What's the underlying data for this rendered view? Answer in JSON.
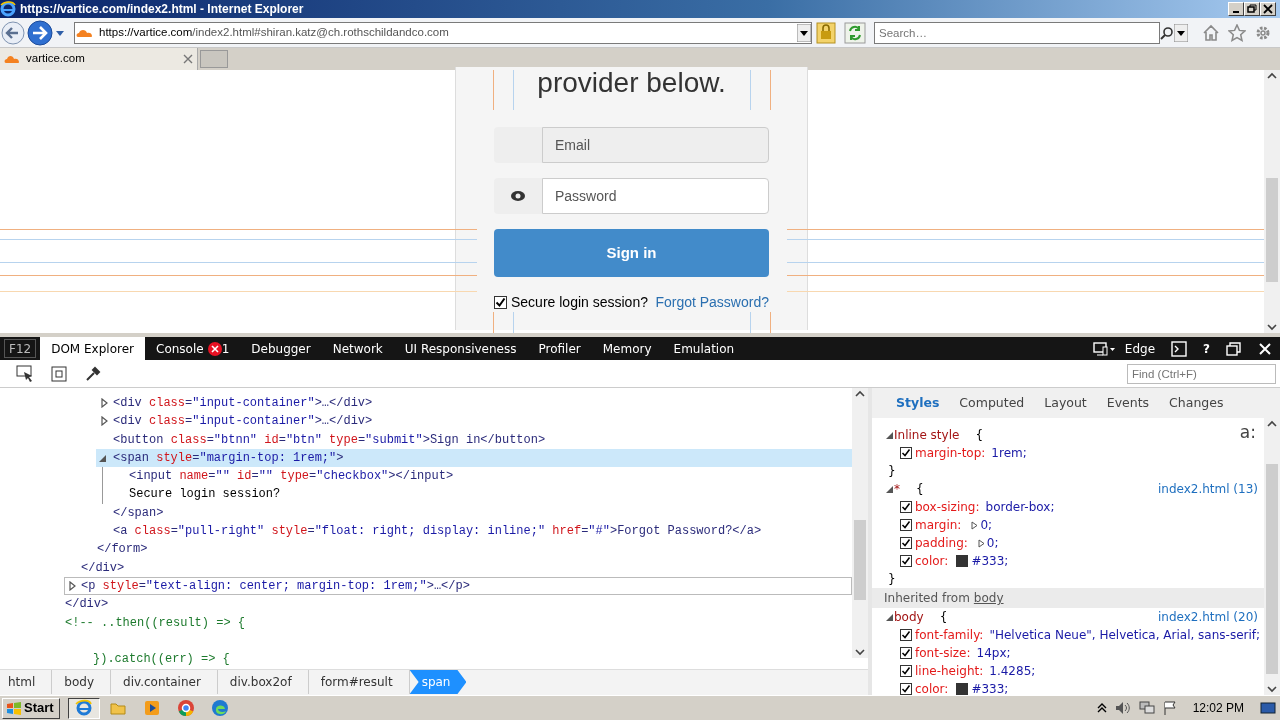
{
  "browser": {
    "title": "https://vartice.com/index2.html - Internet Explorer",
    "address": {
      "host": "https://vartice.com",
      "path": "/index2.html#shiran.katz@ch.rothschildandco.com"
    },
    "search": {
      "placeholder": "Search…"
    },
    "tabs": [
      {
        "label": "vartice.com",
        "selected": true
      }
    ]
  },
  "page": {
    "heading": "provider below.",
    "fields": [
      {
        "kind": "plain",
        "placeholder": "Email",
        "disabled": true
      },
      {
        "kind": "reveal",
        "placeholder": "Password",
        "disabled": false
      }
    ],
    "submit": "Sign in",
    "remember": {
      "label": "Secure login session?",
      "checked": true
    },
    "forgot": "Forgot Password?"
  },
  "devtools": {
    "key_label": "F12",
    "tabs": [
      {
        "label": "DOM Explorer",
        "selected": true
      },
      {
        "label": "Console",
        "selected": false,
        "errors": "1"
      },
      {
        "label": "Debugger",
        "selected": false
      },
      {
        "label": "Network",
        "selected": false
      },
      {
        "label": "UI Responsiveness",
        "selected": false
      },
      {
        "label": "Profiler",
        "selected": false
      },
      {
        "label": "Memory",
        "selected": false
      },
      {
        "label": "Emulation",
        "selected": false
      }
    ],
    "mode": "Edge",
    "help": "?",
    "find": {
      "placeholder": "Find (Ctrl+F)"
    },
    "dom_tree": [
      {
        "close": "</div>",
        "children": [
          {
            "close": "</div>",
            "children": [
              {
                "close": "</form>",
                "children": [
                  {
                    "text": "<div class=\"input-container\">…</div>",
                    "expanded": false,
                    "selected": false,
                    "hovered": false
                  },
                  {
                    "text": "<div class=\"input-container\">…</div>",
                    "expanded": false,
                    "selected": false,
                    "hovered": false
                  },
                  {
                    "text": "<button class=\"btnn\" id=\"btn\" type=\"submit\">Sign in</button>",
                    "selected": false,
                    "hovered": false
                  },
                  {
                    "text": "<span style=\"margin-top: 1rem;\">",
                    "expanded": true,
                    "selected": true,
                    "hovered": false,
                    "close": "</span>",
                    "children": [
                      {
                        "text": "<input name=\"\" id=\"\" type=\"checkbox\"></input>",
                        "selected": false,
                        "hovered": false
                      },
                      {
                        "kind": "text",
                        "text": "Secure login session?",
                        "selected": false,
                        "hovered": false
                      }
                    ]
                  },
                  {
                    "text": "<a class=\"pull-right\" style=\"float: right; display: inline;\" href=\"#\">Forgot Password?</a>",
                    "selected": false,
                    "hovered": false
                  }
                ]
              }
            ]
          },
          {
            "text": "<p style=\"text-align: center; margin-top: 1rem;\">…</p>",
            "expanded": false,
            "selected": false,
            "hovered": true
          }
        ]
      },
      {
        "kind": "comment",
        "lines": [
          "<!-- ..then((result) => {",
          "}).catch((err) => {"
        ]
      }
    ],
    "breadcrumb": [
      {
        "label": "html",
        "selected": false
      },
      {
        "label": "body",
        "selected": false
      },
      {
        "label": "div.container",
        "selected": false
      },
      {
        "label": "div.box2of",
        "selected": false
      },
      {
        "label": "form#result",
        "selected": false
      },
      {
        "label": "span",
        "selected": true
      }
    ],
    "style_tabs": [
      {
        "label": "Styles",
        "selected": true
      },
      {
        "label": "Computed",
        "selected": false
      },
      {
        "label": "Layout",
        "selected": false
      },
      {
        "label": "Events",
        "selected": false
      },
      {
        "label": "Changes",
        "selected": false
      }
    ],
    "pseudo_toggle": "a:",
    "rules": [
      {
        "kind": "rule",
        "selector": "Inline style",
        "open": "{",
        "close": "}",
        "expanded": true,
        "declarations": [
          {
            "property": "margin-top:",
            "value": "1rem;",
            "checked": true
          }
        ]
      },
      {
        "kind": "rule",
        "selector": "*",
        "open": "{",
        "close": "}",
        "source": "index2.html (13)",
        "expanded": true,
        "declarations": [
          {
            "property": "box-sizing:",
            "value": "border-box;",
            "checked": true
          },
          {
            "property": "margin:",
            "value": "0;",
            "checked": true,
            "expandable": true
          },
          {
            "property": "padding:",
            "value": "0;",
            "checked": true,
            "expandable": true
          },
          {
            "property": "color:",
            "value": "#333;",
            "checked": true,
            "swatch": true
          }
        ]
      },
      {
        "kind": "inherited",
        "label": "Inherited from",
        "link": "body"
      },
      {
        "kind": "rule",
        "selector": "body",
        "open": "{",
        "source": "index2.html (20)",
        "expanded": true,
        "declarations": [
          {
            "property": "font-family:",
            "value": "\"Helvetica Neue\", Helvetica, Arial, sans-serif;",
            "checked": true
          },
          {
            "property": "font-size:",
            "value": "14px;",
            "checked": true
          },
          {
            "property": "line-height:",
            "value": "1.4285;",
            "checked": true
          },
          {
            "property": "color:",
            "value": "#333;",
            "checked": true,
            "swatch": true
          }
        ]
      }
    ]
  },
  "taskbar": {
    "start": "Start",
    "apps": [
      {
        "kind": "ie",
        "active": true
      },
      {
        "kind": "folder",
        "active": false
      },
      {
        "kind": "media",
        "active": false
      },
      {
        "kind": "chrome",
        "active": false
      },
      {
        "kind": "edge",
        "active": false
      }
    ],
    "time": "12:02 PM"
  }
}
